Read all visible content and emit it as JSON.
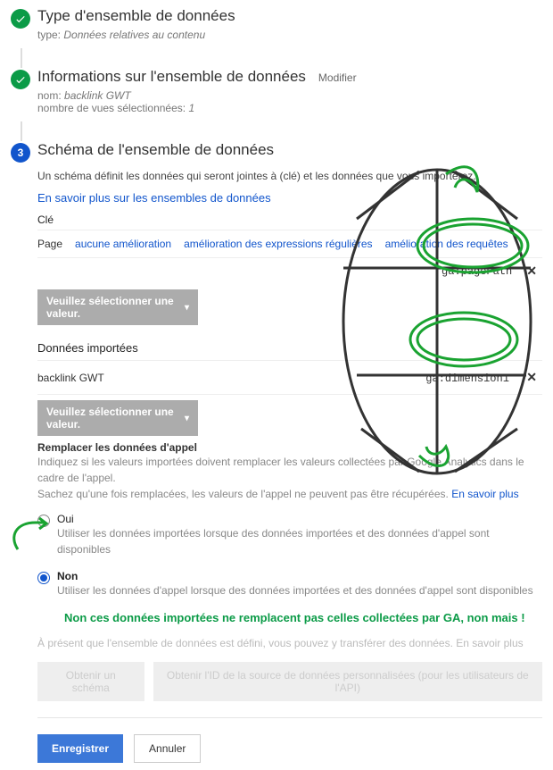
{
  "steps": {
    "type": {
      "title": "Type d'ensemble de données",
      "label": "type:",
      "value": "Données relatives au contenu"
    },
    "info": {
      "title": "Informations sur l'ensemble de données",
      "modify": "Modifier",
      "name_label": "nom:",
      "name_value": "backlink GWT",
      "views_label": "nombre de vues sélectionnées:",
      "views_value": "1"
    },
    "schema": {
      "number": "3",
      "title": "Schéma de l'ensemble de données",
      "description": "Un schéma définit les données qui seront jointes à (clé) et les données que vous importerez.",
      "learn_more": "En savoir plus sur les ensembles de données",
      "key_label": "Clé",
      "key_tabs": {
        "page": "Page",
        "none": "aucune amélioration",
        "regex": "amélioration des expressions régulières",
        "query": "amélioration des requêtes"
      },
      "key_dimension": "ga:pagePath",
      "select_placeholder": "Veuillez sélectionner une valeur.",
      "imported_title": "Données importées",
      "imported_name": "backlink GWT",
      "imported_dimension": "ga:dimension1",
      "replace": {
        "title": "Remplacer les données d'appel",
        "desc1": "Indiquez si les valeurs importées doivent remplacer les valeurs collectées par Google Analytics dans le cadre de l'appel.",
        "desc2_a": "Sachez qu'une fois remplacées, les valeurs de l'appel ne peuvent pas être récupérées.",
        "desc2_link": "En savoir plus",
        "yes_label": "Oui",
        "yes_desc": "Utiliser les données importées lorsque des données importées et des données d'appel sont disponibles",
        "no_label": "Non",
        "no_desc": "Utiliser les données d'appel lorsque des données importées et des données d'appel sont disponibles"
      },
      "annotation": "Non ces données importées ne remplacent pas celles collectées par GA, non mais !",
      "ready_text": "À présent que l'ensemble de données est défini, vous pouvez y transférer des données.",
      "ready_link": "En savoir plus",
      "ghost_get": "Obtenir un schéma",
      "ghost_id": "Obtenir l'ID de la source de données personnalisées (pour les utilisateurs de l'API)"
    }
  },
  "buttons": {
    "save": "Enregistrer",
    "cancel": "Annuler"
  }
}
